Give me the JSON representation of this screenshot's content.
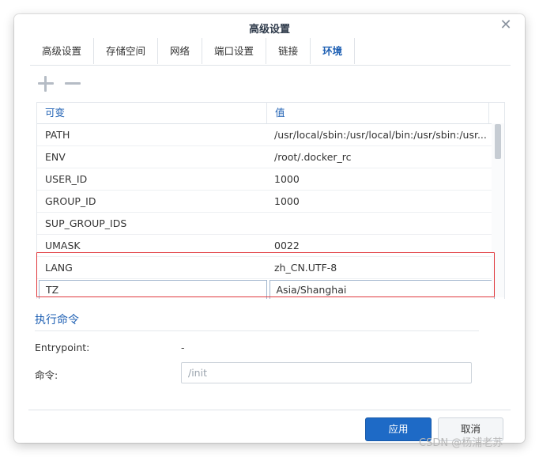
{
  "dialog": {
    "title": "高级设置",
    "close_icon": "close-icon"
  },
  "tabs": [
    {
      "label": "高级设置",
      "active": false
    },
    {
      "label": "存储空间",
      "active": false
    },
    {
      "label": "网络",
      "active": false
    },
    {
      "label": "端口设置",
      "active": false
    },
    {
      "label": "链接",
      "active": false
    },
    {
      "label": "环境",
      "active": true
    }
  ],
  "toolbar": {
    "add_icon": "plus-icon",
    "remove_icon": "minus-icon"
  },
  "env_table": {
    "columns": [
      "可变",
      "值"
    ],
    "rows": [
      {
        "name": "PATH",
        "value": "/usr/local/sbin:/usr/local/bin:/usr/sbin:/usr..."
      },
      {
        "name": "ENV",
        "value": "/root/.docker_rc"
      },
      {
        "name": "USER_ID",
        "value": "1000"
      },
      {
        "name": "GROUP_ID",
        "value": "1000"
      },
      {
        "name": "SUP_GROUP_IDS",
        "value": ""
      },
      {
        "name": "UMASK",
        "value": "0022"
      },
      {
        "name": "LANG",
        "value": "zh_CN.UTF-8"
      },
      {
        "name": "TZ",
        "value": "Asia/Shanghai"
      }
    ]
  },
  "exec": {
    "section_title": "执行命令",
    "entrypoint_label": "Entrypoint:",
    "entrypoint_value": "-",
    "command_label": "命令:",
    "command_placeholder": "/init"
  },
  "footer": {
    "apply_label": "应用",
    "cancel_label": "取消"
  },
  "watermark": "CSDN @杨浦老苏",
  "colors": {
    "accent": "#1d5fb3",
    "apply_button": "#1e6ac6",
    "highlight_border": "#e0393e"
  }
}
